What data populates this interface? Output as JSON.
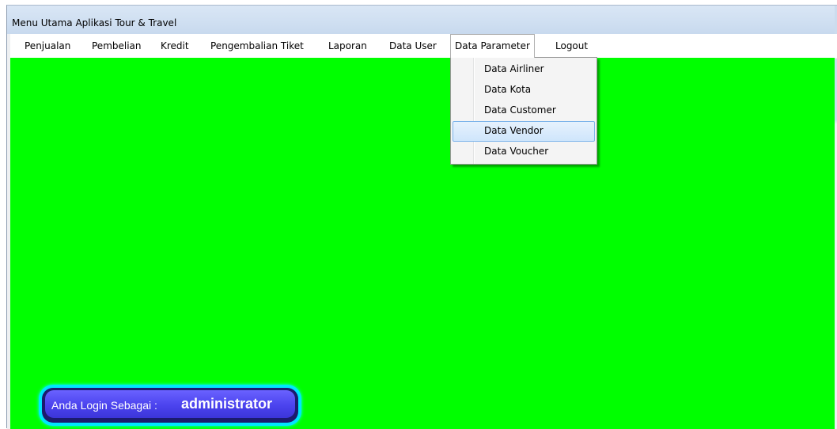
{
  "window": {
    "title": "Menu Utama Aplikasi Tour & Travel"
  },
  "menubar": {
    "items": [
      {
        "label": "Penjualan"
      },
      {
        "label": "Pembelian"
      },
      {
        "label": "Kredit"
      },
      {
        "label": "Pengembalian Tiket"
      },
      {
        "label": "Laporan"
      },
      {
        "label": "Data User"
      },
      {
        "label": "Data Parameter"
      },
      {
        "label": "Logout"
      }
    ],
    "open_menu": "Data Parameter"
  },
  "dropdown": {
    "items": [
      {
        "label": "Data Airliner"
      },
      {
        "label": "Data Kota"
      },
      {
        "label": "Data Customer"
      },
      {
        "label": "Data Vendor"
      },
      {
        "label": "Data Voucher"
      }
    ],
    "highlighted": "Data Vendor"
  },
  "status": {
    "login_label": "Anda Login Sebagai :",
    "username": "administrator"
  },
  "colors": {
    "content_background": "#00ff00",
    "badge_glow": "#00e5ff",
    "badge_face": "#4b43ee",
    "highlight_border": "#7db4ea"
  }
}
